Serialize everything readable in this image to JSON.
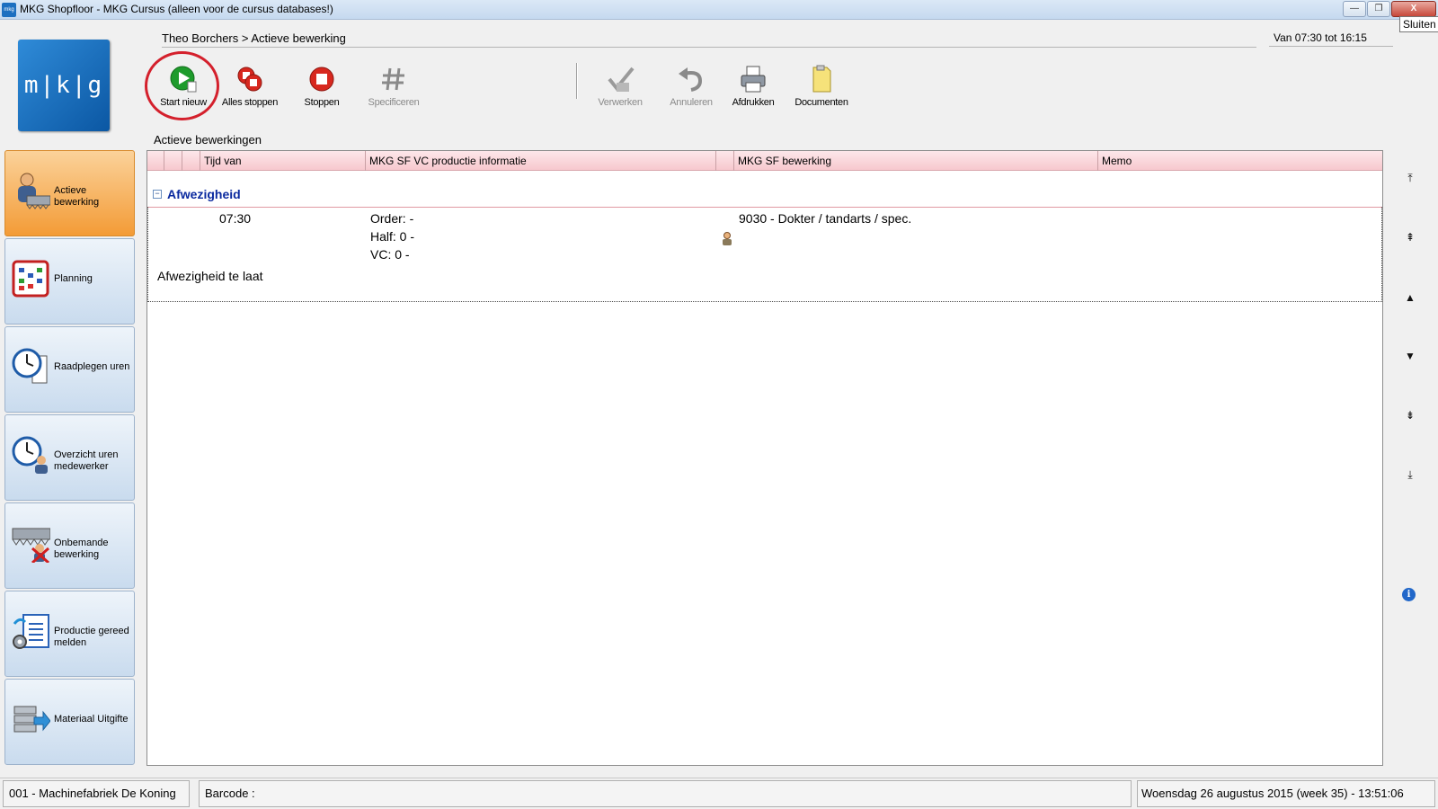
{
  "window": {
    "title": "MKG Shopfloor - MKG Cursus (alleen voor de cursus databases!)",
    "app_icon_text": "mkg",
    "controls": {
      "minimize": "—",
      "maximize": "❐",
      "close": "X"
    },
    "close_tooltip": "Sluiten"
  },
  "logo": {
    "text": "m|k|g"
  },
  "header": {
    "breadcrumb": "Theo Borchers > Actieve bewerking",
    "shift_time": "Van 07:30 tot 16:15"
  },
  "toolbar": {
    "start_new": "Start nieuw",
    "stop_all": "Alles stoppen",
    "stop": "Stoppen",
    "specify": "Specificeren",
    "process": "Verwerken",
    "cancel": "Annuleren",
    "print": "Afdrukken",
    "documents": "Documenten"
  },
  "sidebar": {
    "items": [
      {
        "label": "Actieve bewerking",
        "icon": "worker-saw-icon",
        "active": true
      },
      {
        "label": "Planning",
        "icon": "calendar-grid-icon",
        "active": false
      },
      {
        "label": "Raadplegen uren",
        "icon": "clock-document-icon",
        "active": false
      },
      {
        "label": "Overzicht uren medewerker",
        "icon": "clock-person-icon",
        "active": false
      },
      {
        "label": "Onbemande bewerking",
        "icon": "unmanned-saw-icon",
        "active": false
      },
      {
        "label": "Productie gereed melden",
        "icon": "document-gear-icon",
        "active": false
      },
      {
        "label": "Materiaal Uitgifte",
        "icon": "material-stack-icon",
        "active": false
      }
    ]
  },
  "grid": {
    "caption": "Actieve bewerkingen",
    "columns": [
      "Tijd van",
      "MKG SF VC productie informatie",
      "MKG SF bewerking",
      "Memo"
    ],
    "group": {
      "toggle": "−",
      "label": "Afwezigheid"
    },
    "record": {
      "time_from": "07:30",
      "order": "Order:  -",
      "half": "Half: 0 -",
      "vc": "VC: 0 -",
      "operation": "9030 - Dokter / tandarts / spec.",
      "memo": "",
      "note": "Afwezigheid te laat"
    }
  },
  "scroll_buttons": [
    "⤒",
    "⇞",
    "▲",
    "▼",
    "⇟",
    "⤓"
  ],
  "info": "i",
  "statusbar": {
    "company": "001 - Machinefabriek De Koning",
    "barcode_label": "Barcode :",
    "datetime": "Woensdag 26 augustus 2015 (week 35)  - 13:51:06"
  },
  "colors": {
    "active_nav": "#f39b36",
    "header_pink": "#f7c8ce",
    "group_blue": "#0b2a9f",
    "start_green": "#1e9b2c",
    "stop_red": "#d7281f",
    "highlight_red": "#d4202c"
  }
}
